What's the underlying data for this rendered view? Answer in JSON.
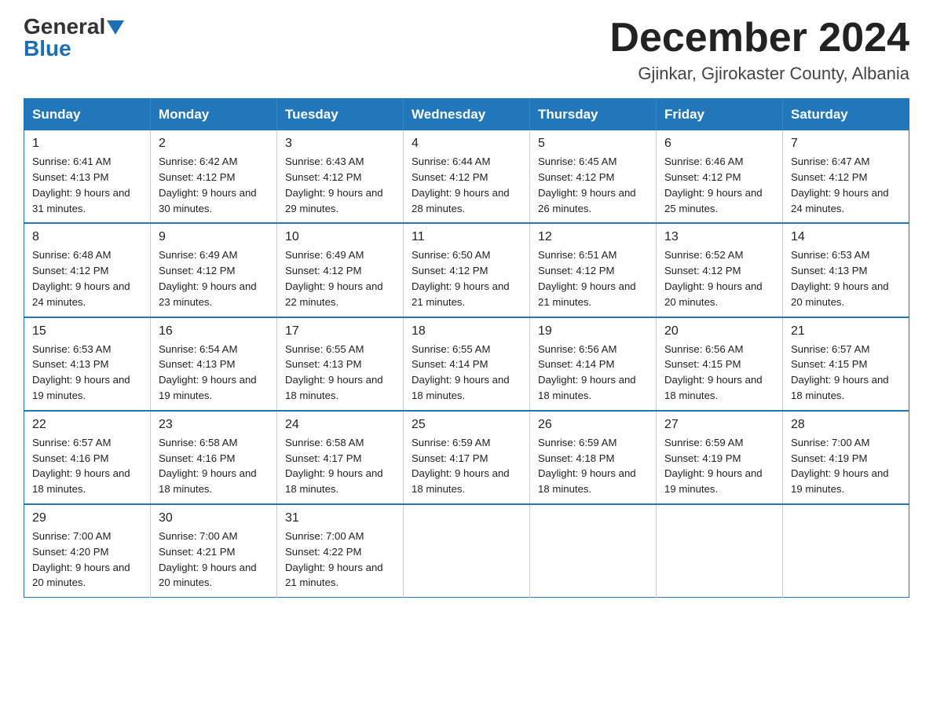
{
  "logo": {
    "general": "General",
    "blue": "Blue"
  },
  "title": "December 2024",
  "subtitle": "Gjinkar, Gjirokaster County, Albania",
  "weekdays": [
    "Sunday",
    "Monday",
    "Tuesday",
    "Wednesday",
    "Thursday",
    "Friday",
    "Saturday"
  ],
  "weeks": [
    [
      {
        "day": "1",
        "sunrise": "Sunrise: 6:41 AM",
        "sunset": "Sunset: 4:13 PM",
        "daylight": "Daylight: 9 hours and 31 minutes."
      },
      {
        "day": "2",
        "sunrise": "Sunrise: 6:42 AM",
        "sunset": "Sunset: 4:12 PM",
        "daylight": "Daylight: 9 hours and 30 minutes."
      },
      {
        "day": "3",
        "sunrise": "Sunrise: 6:43 AM",
        "sunset": "Sunset: 4:12 PM",
        "daylight": "Daylight: 9 hours and 29 minutes."
      },
      {
        "day": "4",
        "sunrise": "Sunrise: 6:44 AM",
        "sunset": "Sunset: 4:12 PM",
        "daylight": "Daylight: 9 hours and 28 minutes."
      },
      {
        "day": "5",
        "sunrise": "Sunrise: 6:45 AM",
        "sunset": "Sunset: 4:12 PM",
        "daylight": "Daylight: 9 hours and 26 minutes."
      },
      {
        "day": "6",
        "sunrise": "Sunrise: 6:46 AM",
        "sunset": "Sunset: 4:12 PM",
        "daylight": "Daylight: 9 hours and 25 minutes."
      },
      {
        "day": "7",
        "sunrise": "Sunrise: 6:47 AM",
        "sunset": "Sunset: 4:12 PM",
        "daylight": "Daylight: 9 hours and 24 minutes."
      }
    ],
    [
      {
        "day": "8",
        "sunrise": "Sunrise: 6:48 AM",
        "sunset": "Sunset: 4:12 PM",
        "daylight": "Daylight: 9 hours and 24 minutes."
      },
      {
        "day": "9",
        "sunrise": "Sunrise: 6:49 AM",
        "sunset": "Sunset: 4:12 PM",
        "daylight": "Daylight: 9 hours and 23 minutes."
      },
      {
        "day": "10",
        "sunrise": "Sunrise: 6:49 AM",
        "sunset": "Sunset: 4:12 PM",
        "daylight": "Daylight: 9 hours and 22 minutes."
      },
      {
        "day": "11",
        "sunrise": "Sunrise: 6:50 AM",
        "sunset": "Sunset: 4:12 PM",
        "daylight": "Daylight: 9 hours and 21 minutes."
      },
      {
        "day": "12",
        "sunrise": "Sunrise: 6:51 AM",
        "sunset": "Sunset: 4:12 PM",
        "daylight": "Daylight: 9 hours and 21 minutes."
      },
      {
        "day": "13",
        "sunrise": "Sunrise: 6:52 AM",
        "sunset": "Sunset: 4:12 PM",
        "daylight": "Daylight: 9 hours and 20 minutes."
      },
      {
        "day": "14",
        "sunrise": "Sunrise: 6:53 AM",
        "sunset": "Sunset: 4:13 PM",
        "daylight": "Daylight: 9 hours and 20 minutes."
      }
    ],
    [
      {
        "day": "15",
        "sunrise": "Sunrise: 6:53 AM",
        "sunset": "Sunset: 4:13 PM",
        "daylight": "Daylight: 9 hours and 19 minutes."
      },
      {
        "day": "16",
        "sunrise": "Sunrise: 6:54 AM",
        "sunset": "Sunset: 4:13 PM",
        "daylight": "Daylight: 9 hours and 19 minutes."
      },
      {
        "day": "17",
        "sunrise": "Sunrise: 6:55 AM",
        "sunset": "Sunset: 4:13 PM",
        "daylight": "Daylight: 9 hours and 18 minutes."
      },
      {
        "day": "18",
        "sunrise": "Sunrise: 6:55 AM",
        "sunset": "Sunset: 4:14 PM",
        "daylight": "Daylight: 9 hours and 18 minutes."
      },
      {
        "day": "19",
        "sunrise": "Sunrise: 6:56 AM",
        "sunset": "Sunset: 4:14 PM",
        "daylight": "Daylight: 9 hours and 18 minutes."
      },
      {
        "day": "20",
        "sunrise": "Sunrise: 6:56 AM",
        "sunset": "Sunset: 4:15 PM",
        "daylight": "Daylight: 9 hours and 18 minutes."
      },
      {
        "day": "21",
        "sunrise": "Sunrise: 6:57 AM",
        "sunset": "Sunset: 4:15 PM",
        "daylight": "Daylight: 9 hours and 18 minutes."
      }
    ],
    [
      {
        "day": "22",
        "sunrise": "Sunrise: 6:57 AM",
        "sunset": "Sunset: 4:16 PM",
        "daylight": "Daylight: 9 hours and 18 minutes."
      },
      {
        "day": "23",
        "sunrise": "Sunrise: 6:58 AM",
        "sunset": "Sunset: 4:16 PM",
        "daylight": "Daylight: 9 hours and 18 minutes."
      },
      {
        "day": "24",
        "sunrise": "Sunrise: 6:58 AM",
        "sunset": "Sunset: 4:17 PM",
        "daylight": "Daylight: 9 hours and 18 minutes."
      },
      {
        "day": "25",
        "sunrise": "Sunrise: 6:59 AM",
        "sunset": "Sunset: 4:17 PM",
        "daylight": "Daylight: 9 hours and 18 minutes."
      },
      {
        "day": "26",
        "sunrise": "Sunrise: 6:59 AM",
        "sunset": "Sunset: 4:18 PM",
        "daylight": "Daylight: 9 hours and 18 minutes."
      },
      {
        "day": "27",
        "sunrise": "Sunrise: 6:59 AM",
        "sunset": "Sunset: 4:19 PM",
        "daylight": "Daylight: 9 hours and 19 minutes."
      },
      {
        "day": "28",
        "sunrise": "Sunrise: 7:00 AM",
        "sunset": "Sunset: 4:19 PM",
        "daylight": "Daylight: 9 hours and 19 minutes."
      }
    ],
    [
      {
        "day": "29",
        "sunrise": "Sunrise: 7:00 AM",
        "sunset": "Sunset: 4:20 PM",
        "daylight": "Daylight: 9 hours and 20 minutes."
      },
      {
        "day": "30",
        "sunrise": "Sunrise: 7:00 AM",
        "sunset": "Sunset: 4:21 PM",
        "daylight": "Daylight: 9 hours and 20 minutes."
      },
      {
        "day": "31",
        "sunrise": "Sunrise: 7:00 AM",
        "sunset": "Sunset: 4:22 PM",
        "daylight": "Daylight: 9 hours and 21 minutes."
      },
      null,
      null,
      null,
      null
    ]
  ]
}
